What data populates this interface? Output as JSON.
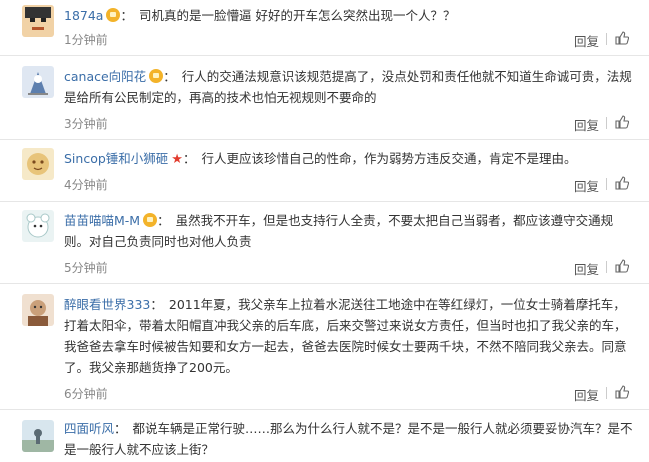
{
  "comments": [
    {
      "user": "1874a",
      "badge": "crown",
      "text": "司机真的是一脸懵逼 好好的开车怎么突然出现一个人？？",
      "time": "1分钟前",
      "reply": "回复"
    },
    {
      "user": "canace向阳花",
      "badge": "crown",
      "text": "行人的交通法规意识该规范提高了，没点处罚和责任他就不知道生命诚可贵，法规是给所有公民制定的，再高的技术也怕无视规则不要命的",
      "time": "3分钟前",
      "reply": "回复"
    },
    {
      "user": "Sincop锤和小狮砸",
      "badge": "star",
      "text": "行人更应该珍惜自己的性命，作为弱势方违反交通，肯定不是理由。",
      "time": "4分钟前",
      "reply": "回复"
    },
    {
      "user": "苗苗喵喵M-M",
      "badge": "crown",
      "text": "虽然我不开车，但是也支持行人全责，不要太把自己当弱者，都应该遵守交通规则。对自己负责同时也对他人负责",
      "time": "5分钟前",
      "reply": "回复"
    },
    {
      "user": "醉眼看世界333",
      "badge": "none",
      "text": "2011年夏，我父亲车上拉着水泥送往工地途中在等红绿灯，一位女士骑着摩托车，打着太阳伞，带着太阳帽直冲我父亲的后车底，后来交警过来说女方责任，但当时也扣了我父亲的车，我爸爸去拿车时候被告知要和女方一起去，爸爸去医院时候女士要两千块，不然不陪同我父亲去。同意了。我父亲那趟货挣了200元。",
      "time": "6分钟前",
      "reply": "回复"
    },
    {
      "user": "四面听风",
      "badge": "none",
      "text": "都说车辆是正常行驶……那么为什么行人就不是？是不是一般行人就必须要妥协汽车？是不是一般行人就不应该上街？",
      "time": "",
      "reply": ""
    }
  ]
}
